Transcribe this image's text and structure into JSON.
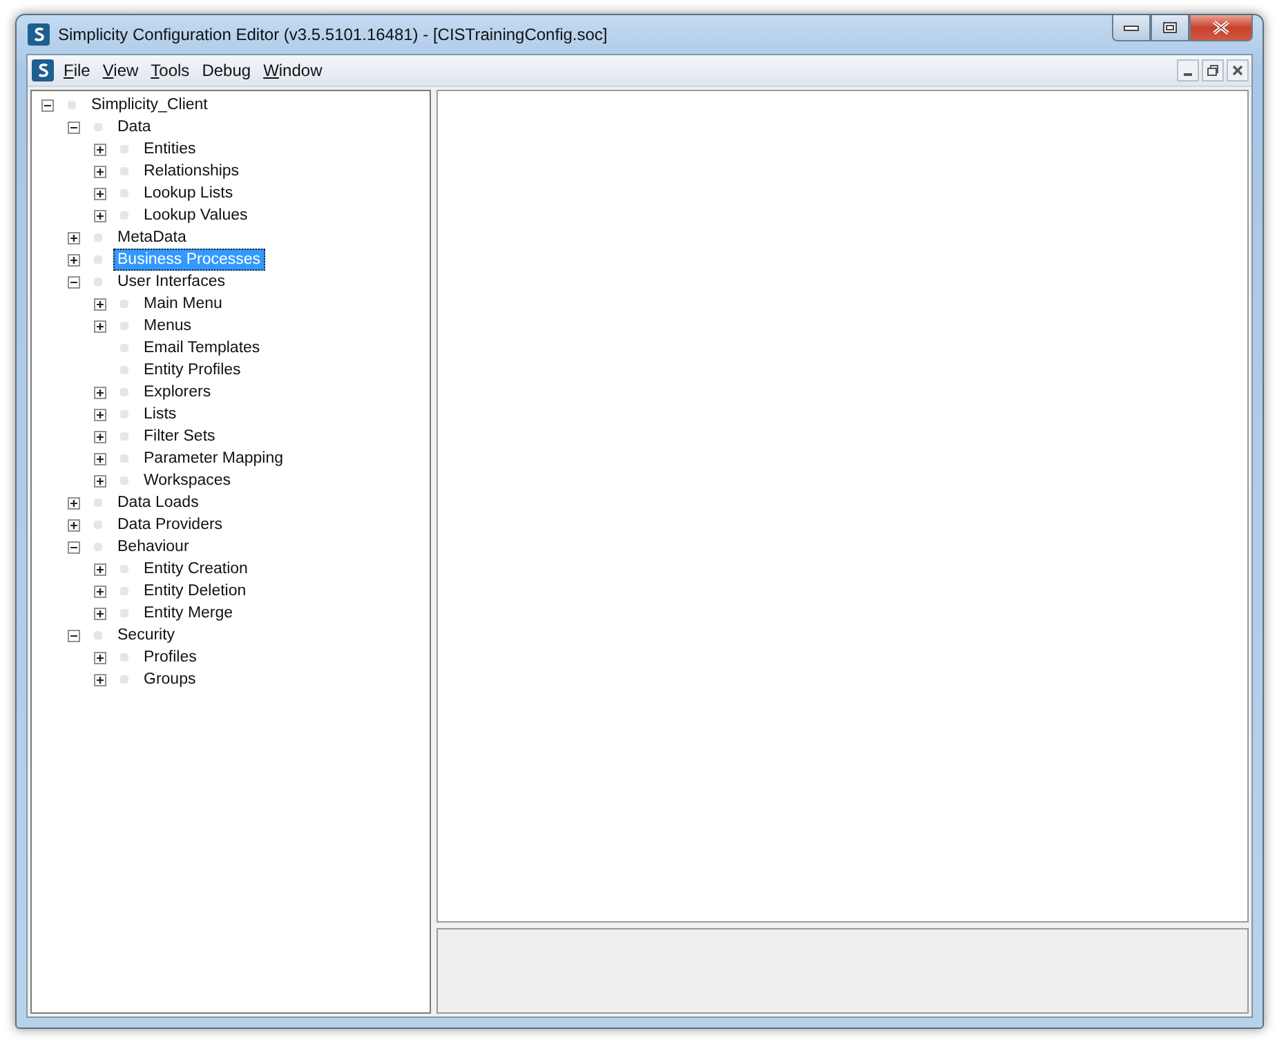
{
  "window": {
    "title": "Simplicity Configuration Editor (v3.5.5101.16481) - [CISTrainingConfig.soc]"
  },
  "menu": [
    {
      "key": "F",
      "after": "ile"
    },
    {
      "key": "V",
      "after": "iew"
    },
    {
      "key": "T",
      "after": "ools"
    },
    {
      "before": "Debug"
    },
    {
      "key": "W",
      "after": "indow"
    }
  ],
  "tree": [
    {
      "label": "Simplicity_Client",
      "expandable": true,
      "expanded": true,
      "selected": false,
      "children": [
        {
          "label": "Data",
          "expandable": true,
          "expanded": true,
          "selected": false,
          "children": [
            {
              "label": "Entities",
              "expandable": true,
              "expanded": false,
              "selected": false
            },
            {
              "label": "Relationships",
              "expandable": true,
              "expanded": false,
              "selected": false
            },
            {
              "label": "Lookup Lists",
              "expandable": true,
              "expanded": false,
              "selected": false
            },
            {
              "label": "Lookup Values",
              "expandable": true,
              "expanded": false,
              "selected": false
            }
          ]
        },
        {
          "label": "MetaData",
          "expandable": true,
          "expanded": false,
          "selected": false
        },
        {
          "label": "Business Processes",
          "expandable": true,
          "expanded": false,
          "selected": true
        },
        {
          "label": "User Interfaces",
          "expandable": true,
          "expanded": true,
          "selected": false,
          "children": [
            {
              "label": "Main Menu",
              "expandable": true,
              "expanded": false,
              "selected": false
            },
            {
              "label": "Menus",
              "expandable": true,
              "expanded": false,
              "selected": false
            },
            {
              "label": "Email Templates",
              "expandable": false,
              "selected": false
            },
            {
              "label": "Entity Profiles",
              "expandable": false,
              "selected": false
            },
            {
              "label": "Explorers",
              "expandable": true,
              "expanded": false,
              "selected": false
            },
            {
              "label": "Lists",
              "expandable": true,
              "expanded": false,
              "selected": false
            },
            {
              "label": "Filter Sets",
              "expandable": true,
              "expanded": false,
              "selected": false
            },
            {
              "label": "Parameter Mapping",
              "expandable": true,
              "expanded": false,
              "selected": false
            },
            {
              "label": "Workspaces",
              "expandable": true,
              "expanded": false,
              "selected": false
            }
          ]
        },
        {
          "label": "Data Loads",
          "expandable": true,
          "expanded": false,
          "selected": false
        },
        {
          "label": "Data Providers",
          "expandable": true,
          "expanded": false,
          "selected": false
        },
        {
          "label": "Behaviour",
          "expandable": true,
          "expanded": true,
          "selected": false,
          "children": [
            {
              "label": "Entity Creation",
              "expandable": true,
              "expanded": false,
              "selected": false
            },
            {
              "label": "Entity Deletion",
              "expandable": true,
              "expanded": false,
              "selected": false
            },
            {
              "label": "Entity Merge",
              "expandable": true,
              "expanded": false,
              "selected": false
            }
          ]
        },
        {
          "label": "Security",
          "expandable": true,
          "expanded": true,
          "selected": false,
          "children": [
            {
              "label": "Profiles",
              "expandable": true,
              "expanded": false,
              "selected": false
            },
            {
              "label": "Groups",
              "expandable": true,
              "expanded": false,
              "selected": false
            }
          ]
        }
      ]
    }
  ]
}
